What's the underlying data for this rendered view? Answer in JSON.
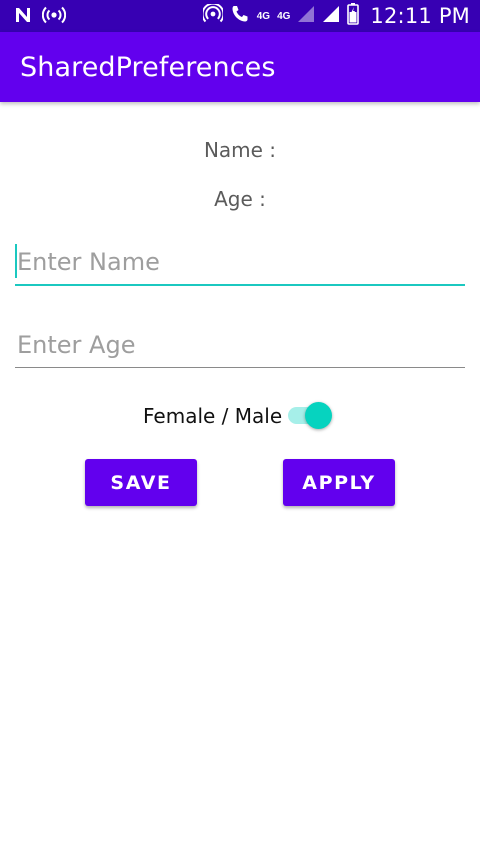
{
  "status_bar": {
    "time": "12:11 PM",
    "network_primary": "4G",
    "network_secondary": "4G",
    "icons": [
      "n-notification-icon",
      "broadcast-icon",
      "hotspot-icon",
      "volte-call-icon",
      "signal-icon",
      "battery-icon"
    ]
  },
  "app_bar": {
    "title": "SharedPreferences"
  },
  "form": {
    "name_label": "Name :",
    "age_label": "Age :",
    "name_placeholder": "Enter Name",
    "name_value": "",
    "age_placeholder": "Enter Age",
    "age_value": "",
    "switch_label": "Female / Male",
    "switch_on": true,
    "save_label": "SAVE",
    "apply_label": "APPLY"
  },
  "colors": {
    "status_bar": "#3700b3",
    "primary": "#6200ee",
    "accent": "#06d3bf"
  }
}
